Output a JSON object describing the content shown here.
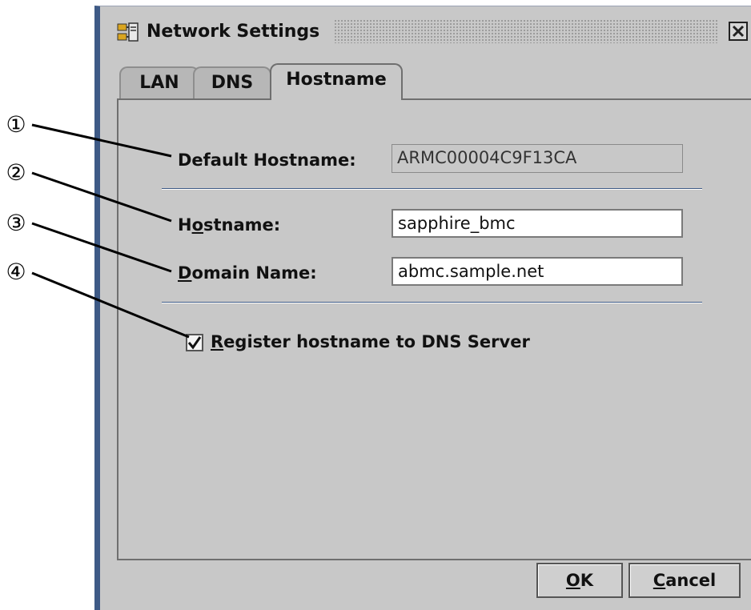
{
  "callouts": [
    "①",
    "②",
    "③",
    "④"
  ],
  "window": {
    "title": "Network Settings",
    "icon": "network-computer-icon",
    "close_icon": "close-icon"
  },
  "tabs": [
    {
      "label": "LAN",
      "active": false
    },
    {
      "label": "DNS",
      "active": false
    },
    {
      "label": "Hostname",
      "active": true
    }
  ],
  "form": {
    "default_hostname_label": "Default Hostname:",
    "default_hostname_value": "ARMC00004C9F13CA",
    "hostname_label_pre": "H",
    "hostname_label_mnemonic": "o",
    "hostname_label_post": "stname:",
    "hostname_value": "sapphire_bmc",
    "domain_label_mnemonic": "D",
    "domain_label_post": "omain Name:",
    "domain_value": "abmc.sample.net",
    "register_checked": true,
    "register_mnemonic": "R",
    "register_label_post": "egister hostname to DNS Server"
  },
  "buttons": {
    "ok_mnemonic": "O",
    "ok_post": "K",
    "cancel_mnemonic": "C",
    "cancel_post": "ancel"
  },
  "colors": {
    "window_bg": "#c8c8c8",
    "frame_accent": "#3e5a86",
    "divider": "#3e5a86"
  }
}
